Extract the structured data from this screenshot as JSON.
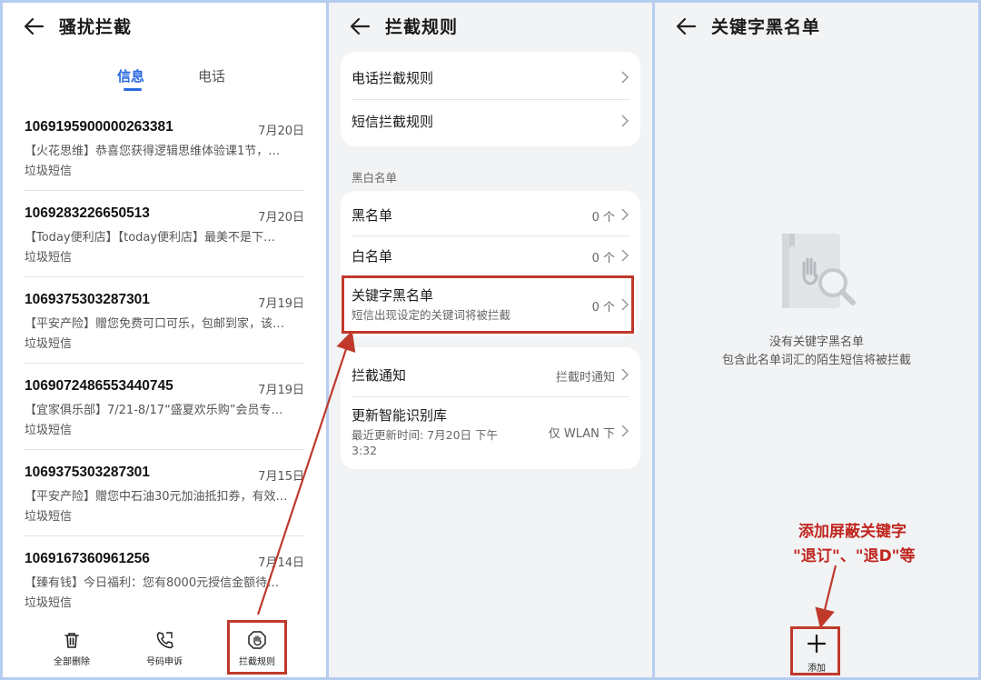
{
  "panel1": {
    "title": "骚扰拦截",
    "tabs": {
      "messages": "信息",
      "calls": "电话"
    },
    "messages": [
      {
        "number": "1069195900000263381",
        "date": "7月20日",
        "body": "【火花思维】恭喜您获得逻辑思维体验课1节，…",
        "tag": "垃圾短信"
      },
      {
        "number": "1069283226650513",
        "date": "7月20日",
        "body": "【Today便利店】【today便利店】最美不是下…",
        "tag": "垃圾短信"
      },
      {
        "number": "1069375303287301",
        "date": "7月19日",
        "body": "【平安产险】赠您免费可口可乐，包邮到家，该…",
        "tag": "垃圾短信"
      },
      {
        "number": "1069072486553440745",
        "date": "7月19日",
        "body": "【宜家俱乐部】7/21-8/17“盛夏欢乐购”会员专…",
        "tag": "垃圾短信"
      },
      {
        "number": "1069375303287301",
        "date": "7月15日",
        "body": "【平安产险】赠您中石油30元加油抵扣券，有效…",
        "tag": "垃圾短信"
      },
      {
        "number": "1069167360961256",
        "date": "7月14日",
        "body": "【臻有钱】今日福利：您有8000元授信金额待…",
        "tag": "垃圾短信"
      }
    ],
    "bottom_bar": {
      "delete_all": "全部删除",
      "report": "号码申诉",
      "rules": "拦截规则"
    }
  },
  "panel2": {
    "title": "拦截规则",
    "call_rules": "电话拦截规则",
    "sms_rules": "短信拦截规则",
    "section_title": "黑白名单",
    "blacklist": {
      "label": "黑名单",
      "value": "0 个"
    },
    "whitelist": {
      "label": "白名单",
      "value": "0 个"
    },
    "keyword_blacklist": {
      "label": "关键字黑名单",
      "sub": "短信出现设定的关键词将被拦截",
      "value": "0 个"
    },
    "notify": {
      "label": "拦截通知",
      "value": "拦截时通知"
    },
    "update": {
      "label": "更新智能识别库",
      "sub1": "最近更新时间: 7月20日 下午",
      "sub2": "3:32",
      "value": "仅 WLAN 下"
    }
  },
  "panel3": {
    "title": "关键字黑名单",
    "empty_title": "没有关键字黑名单",
    "empty_desc": "包含此名单词汇的陌生短信将被拦截",
    "annotation_line1": "添加屏蔽关键字",
    "annotation_line2": "\"退订\"、\"退D\"等",
    "add_label": "添加"
  },
  "colors": {
    "accent": "#2a6ae0",
    "highlight": "#c0392b",
    "annotation": "#c0261f"
  }
}
